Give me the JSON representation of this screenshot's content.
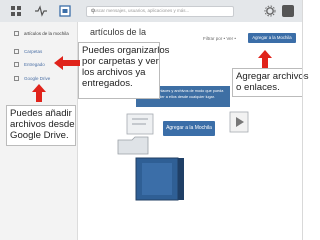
{
  "search": {
    "placeholder": "Buscar mensajes, usuarios, aplicaciones y más..."
  },
  "sidebar": {
    "items": [
      {
        "label": "artículos de la mochila",
        "active": true
      },
      {
        "label": "Carpetas"
      },
      {
        "label": "Entregado"
      },
      {
        "label": "Google Drive"
      }
    ]
  },
  "main": {
    "title": "artículos de la",
    "toolbar": {
      "filter_text": "Filtrar por  •  Ver  •",
      "add_button": "Agregar a la Mochila"
    },
    "banner": {
      "line1": "Agregar enlaces y archivos de modo que pueda",
      "line2": "acceder a ellos desde cualquier lugar."
    },
    "center_button": "Agregar a la Mochila"
  },
  "callouts": {
    "folders": {
      "lines": [
        "Puedes organizarlos",
        "por carpetas y ver",
        "los archivos ya",
        "entregados."
      ]
    },
    "add": {
      "lines": [
        "Agregar archivos",
        "o enlaces."
      ]
    },
    "drive": {
      "lines": [
        "Puedes añadir",
        "archivos desde",
        "Google Drive."
      ]
    }
  },
  "colors": {
    "accent": "#3b6ea8",
    "arrow": "#e0231b",
    "topbar": "#e4e7ea"
  },
  "icons": [
    "grid-icon",
    "activity-icon",
    "backpack-icon",
    "search-icon",
    "gear-icon",
    "user-icon",
    "folder-icon",
    "document-icon",
    "video-icon",
    "book-icon"
  ]
}
